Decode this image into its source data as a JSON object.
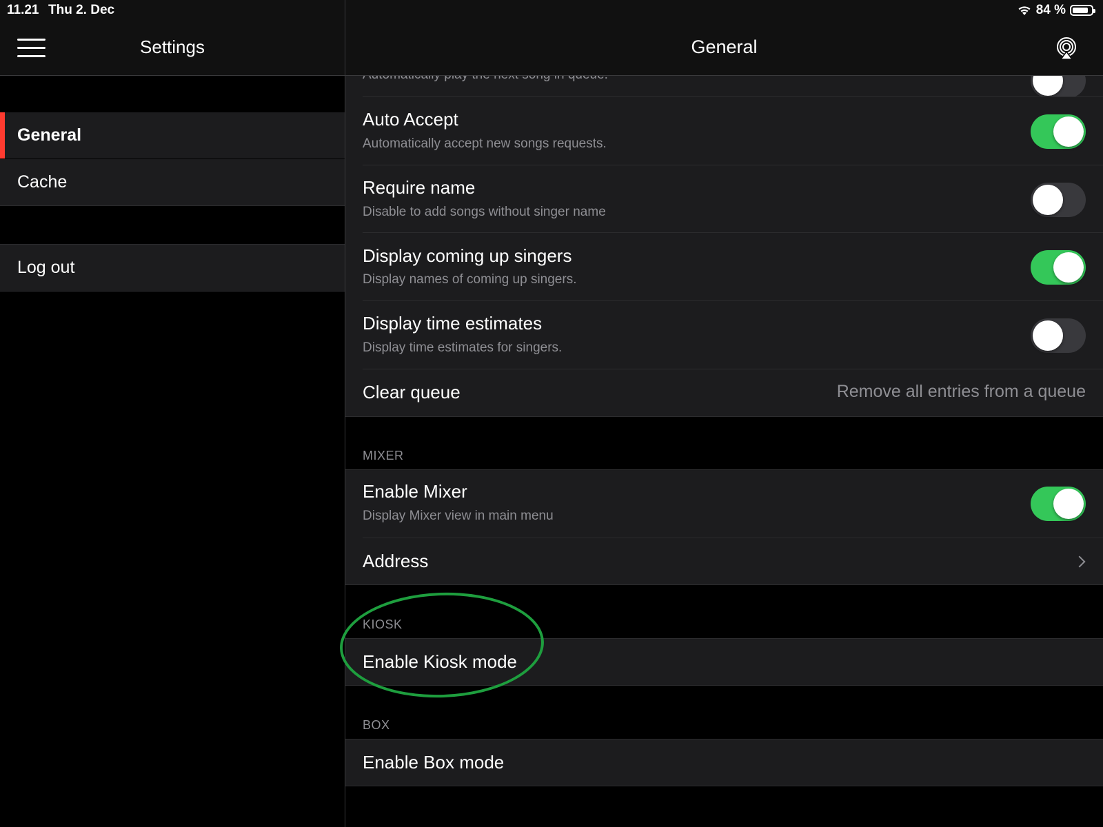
{
  "status_bar": {
    "time": "11.21",
    "date": "Thu 2. Dec",
    "battery_text": "84 %",
    "battery_level": 0.84
  },
  "sidebar": {
    "title": "Settings",
    "items": [
      {
        "label": "General",
        "active": true
      },
      {
        "label": "Cache",
        "active": false
      }
    ],
    "logout_label": "Log out",
    "active_marker_color": "#ff3b30"
  },
  "main": {
    "title": "General",
    "partial_row_subtitle": "Automatically play the next song in queue.",
    "rows": [
      {
        "title": "Auto Accept",
        "subtitle": "Automatically accept new songs requests.",
        "toggle": true
      },
      {
        "title": "Require name",
        "subtitle": "Disable to add songs without singer name",
        "toggle": false
      },
      {
        "title": "Display coming up singers",
        "subtitle": "Display names of coming up singers.",
        "toggle": true
      },
      {
        "title": "Display time estimates",
        "subtitle": "Display time estimates for singers.",
        "toggle": false
      }
    ],
    "clear_queue": {
      "title": "Clear queue",
      "detail": "Remove all entries from a queue"
    },
    "mixer": {
      "header": "MIXER",
      "enable_title": "Enable Mixer",
      "enable_subtitle": "Display Mixer view in main menu",
      "enable_toggle": true,
      "address_title": "Address"
    },
    "kiosk": {
      "header": "KIOSK",
      "enable_title": "Enable Kiosk mode"
    },
    "box": {
      "header": "BOX",
      "enable_title": "Enable Box mode"
    }
  },
  "colors": {
    "toggle_on": "#34c759",
    "toggle_off": "#39393d",
    "annotation_circle": "#1e9e3e"
  },
  "icons": [
    "hamburger-menu-icon",
    "airplay-icon",
    "wifi-icon",
    "battery-icon",
    "chevron-right-icon"
  ]
}
